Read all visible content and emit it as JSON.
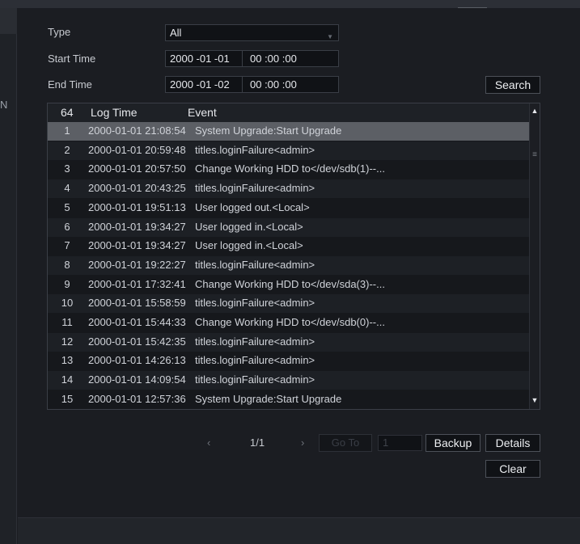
{
  "left_panel": {
    "partial_text": "N"
  },
  "filters": {
    "type_label": "Type",
    "type_value": "All",
    "start_label": "Start Time",
    "start_date": "2000 -01 -01",
    "start_time": "00 :00 :00",
    "end_label": "End Time",
    "end_date": "2000 -01 -02",
    "end_time": "00 :00 :00",
    "search_label": "Search"
  },
  "table": {
    "count_header": "64",
    "time_header": "Log Time",
    "event_header": "Event",
    "rows": [
      {
        "idx": "1",
        "time": "2000-01-01 21:08:54",
        "event": "System Upgrade:Start Upgrade"
      },
      {
        "idx": "2",
        "time": "2000-01-01 20:59:48",
        "event": "titles.loginFailure<admin>"
      },
      {
        "idx": "3",
        "time": "2000-01-01 20:57:50",
        "event": "Change Working HDD to</dev/sdb(1)--..."
      },
      {
        "idx": "4",
        "time": "2000-01-01 20:43:25",
        "event": "titles.loginFailure<admin>"
      },
      {
        "idx": "5",
        "time": "2000-01-01 19:51:13",
        "event": "User logged out.<Local>"
      },
      {
        "idx": "6",
        "time": "2000-01-01 19:34:27",
        "event": "User logged in.<Local>"
      },
      {
        "idx": "7",
        "time": "2000-01-01 19:34:27",
        "event": "User logged in.<Local>"
      },
      {
        "idx": "8",
        "time": "2000-01-01 19:22:27",
        "event": "titles.loginFailure<admin>"
      },
      {
        "idx": "9",
        "time": "2000-01-01 17:32:41",
        "event": "Change Working HDD to</dev/sda(3)--..."
      },
      {
        "idx": "10",
        "time": "2000-01-01 15:58:59",
        "event": "titles.loginFailure<admin>"
      },
      {
        "idx": "11",
        "time": "2000-01-01 15:44:33",
        "event": "Change Working HDD to</dev/sdb(0)--..."
      },
      {
        "idx": "12",
        "time": "2000-01-01 15:42:35",
        "event": "titles.loginFailure<admin>"
      },
      {
        "idx": "13",
        "time": "2000-01-01 14:26:13",
        "event": "titles.loginFailure<admin>"
      },
      {
        "idx": "14",
        "time": "2000-01-01 14:09:54",
        "event": "titles.loginFailure<admin>"
      },
      {
        "idx": "15",
        "time": "2000-01-01 12:57:36",
        "event": "System Upgrade:Start Upgrade"
      }
    ]
  },
  "pagination": {
    "prev_icon": "‹",
    "page_indicator": "1/1",
    "next_icon": "›",
    "goto_label": "Go To",
    "goto_value": "1"
  },
  "actions": {
    "backup_label": "Backup",
    "details_label": "Details",
    "clear_label": "Clear"
  },
  "colors": {
    "background": "#1b1d22",
    "row_even": "#1d2025",
    "row_odd": "#16181c",
    "row_selected": "#5c5f65"
  }
}
